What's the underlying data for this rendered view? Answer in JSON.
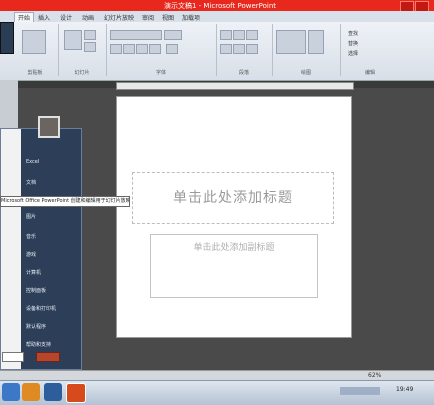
{
  "window": {
    "title": "演示文稿1 - Microsoft PowerPoint"
  },
  "ribbon": {
    "tabs": [
      "开始",
      "插入",
      "设计",
      "动画",
      "幻灯片放映",
      "审阅",
      "视图",
      "加载项"
    ],
    "groups": [
      "剪贴板",
      "幻灯片",
      "字体",
      "段落",
      "绘图",
      "编辑"
    ],
    "buttons": {
      "find": "查找",
      "replace": "替换",
      "select": "选择"
    }
  },
  "slide": {
    "title_placeholder": "单击此处添加标题",
    "subtitle_placeholder": "单击此处添加副标题"
  },
  "start_menu": {
    "items": [
      "Excel",
      "文档",
      "图片",
      "音乐",
      "游戏",
      "计算机",
      "控制面板",
      "设备和打印机",
      "默认程序",
      "帮助和支持"
    ],
    "tooltip": "Microsoft Office PowerPoint 创建和编辑用于幻灯片放映的演示文稿"
  },
  "status_bar": {
    "zoom": "62%"
  },
  "taskbar": {
    "time": "19:49"
  },
  "colors": {
    "titlebar": "#e8281c",
    "startmenu_right": "#2d3e58",
    "taskbar": "#c6d1de"
  }
}
